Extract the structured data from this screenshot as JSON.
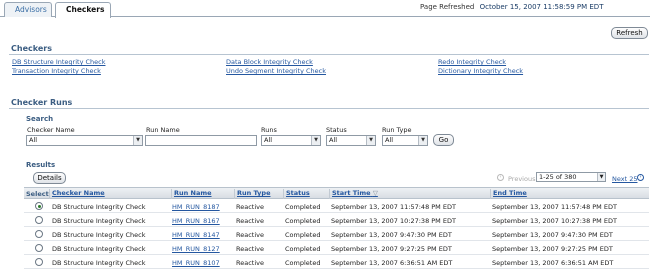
{
  "tabs": [
    {
      "label": "Advisors",
      "active": false
    },
    {
      "label": "Checkers",
      "active": true
    }
  ],
  "page_refreshed": {
    "label": "Page Refreshed",
    "value": "October 15, 2007 11:58:59 PM EDT",
    "button": "Refresh"
  },
  "checkers": {
    "title": "Checkers",
    "links": [
      "DB Structure Integrity Check",
      "Transaction Integrity Check",
      "Data Block Integrity Check",
      "Undo Segment Integrity Check",
      "Redo Integrity Check",
      "Dictionary Integrity Check"
    ]
  },
  "checker_runs": {
    "title": "Checker Runs",
    "search": {
      "title": "Search",
      "checker_name": {
        "label": "Checker Name",
        "value": "All"
      },
      "run_name": {
        "label": "Run Name",
        "value": ""
      },
      "runs": {
        "label": "Runs",
        "value": "All"
      },
      "status": {
        "label": "Status",
        "value": "All"
      },
      "run_type": {
        "label": "Run Type",
        "value": "All"
      },
      "go_button": "Go"
    },
    "results": {
      "title": "Results",
      "detail_button": "Details",
      "pager": {
        "previous": "Previous",
        "range": "1-25 of 380",
        "next": "Next 25"
      },
      "columns": [
        "Select",
        "Checker Name",
        "Run Name",
        "Run Type",
        "Status",
        "Start Time",
        "End Time"
      ],
      "rows": [
        {
          "selected": true,
          "checker": "DB Structure Integrity Check",
          "run_name": "HM_RUN_8187",
          "run_type": "Reactive",
          "status": "Completed",
          "start": "September 13, 2007 11:57:48 PM EDT",
          "end": "September 13, 2007 11:57:48 PM EDT"
        },
        {
          "selected": false,
          "checker": "DB Structure Integrity Check",
          "run_name": "HM_RUN_8167",
          "run_type": "Reactive",
          "status": "Completed",
          "start": "September 13, 2007 10:27:38 PM EDT",
          "end": "September 13, 2007 10:27:38 PM EDT"
        },
        {
          "selected": false,
          "checker": "DB Structure Integrity Check",
          "run_name": "HM_RUN_8147",
          "run_type": "Reactive",
          "status": "Completed",
          "start": "September 13, 2007 9:47:30 PM EDT",
          "end": "September 13, 2007 9:47:30 PM EDT"
        },
        {
          "selected": false,
          "checker": "DB Structure Integrity Check",
          "run_name": "HM_RUN_8127",
          "run_type": "Reactive",
          "status": "Completed",
          "start": "September 13, 2007 9:27:25 PM EDT",
          "end": "September 13, 2007 9:27:25 PM EDT"
        },
        {
          "selected": false,
          "checker": "DB Structure Integrity Check",
          "run_name": "HM_RUN_8107",
          "run_type": "Reactive",
          "status": "Completed",
          "start": "September 13, 2007 6:36:51 AM EDT",
          "end": "September 13, 2007 6:36:51 AM EDT"
        }
      ]
    }
  }
}
